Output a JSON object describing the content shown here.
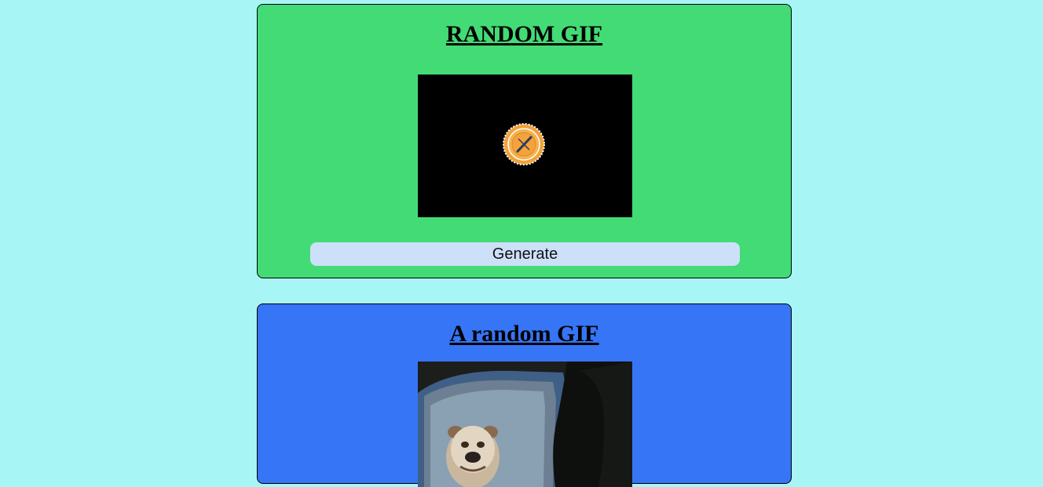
{
  "random_card": {
    "title": "RANDOM GIF",
    "generate_label": "Generate",
    "background": "#43db75"
  },
  "tag_card": {
    "title": "A random GIF",
    "background": "#3675f5"
  },
  "page": {
    "background": "#a8f5f5"
  },
  "icons": {
    "loading_badge": "loading-spinner-icon"
  }
}
